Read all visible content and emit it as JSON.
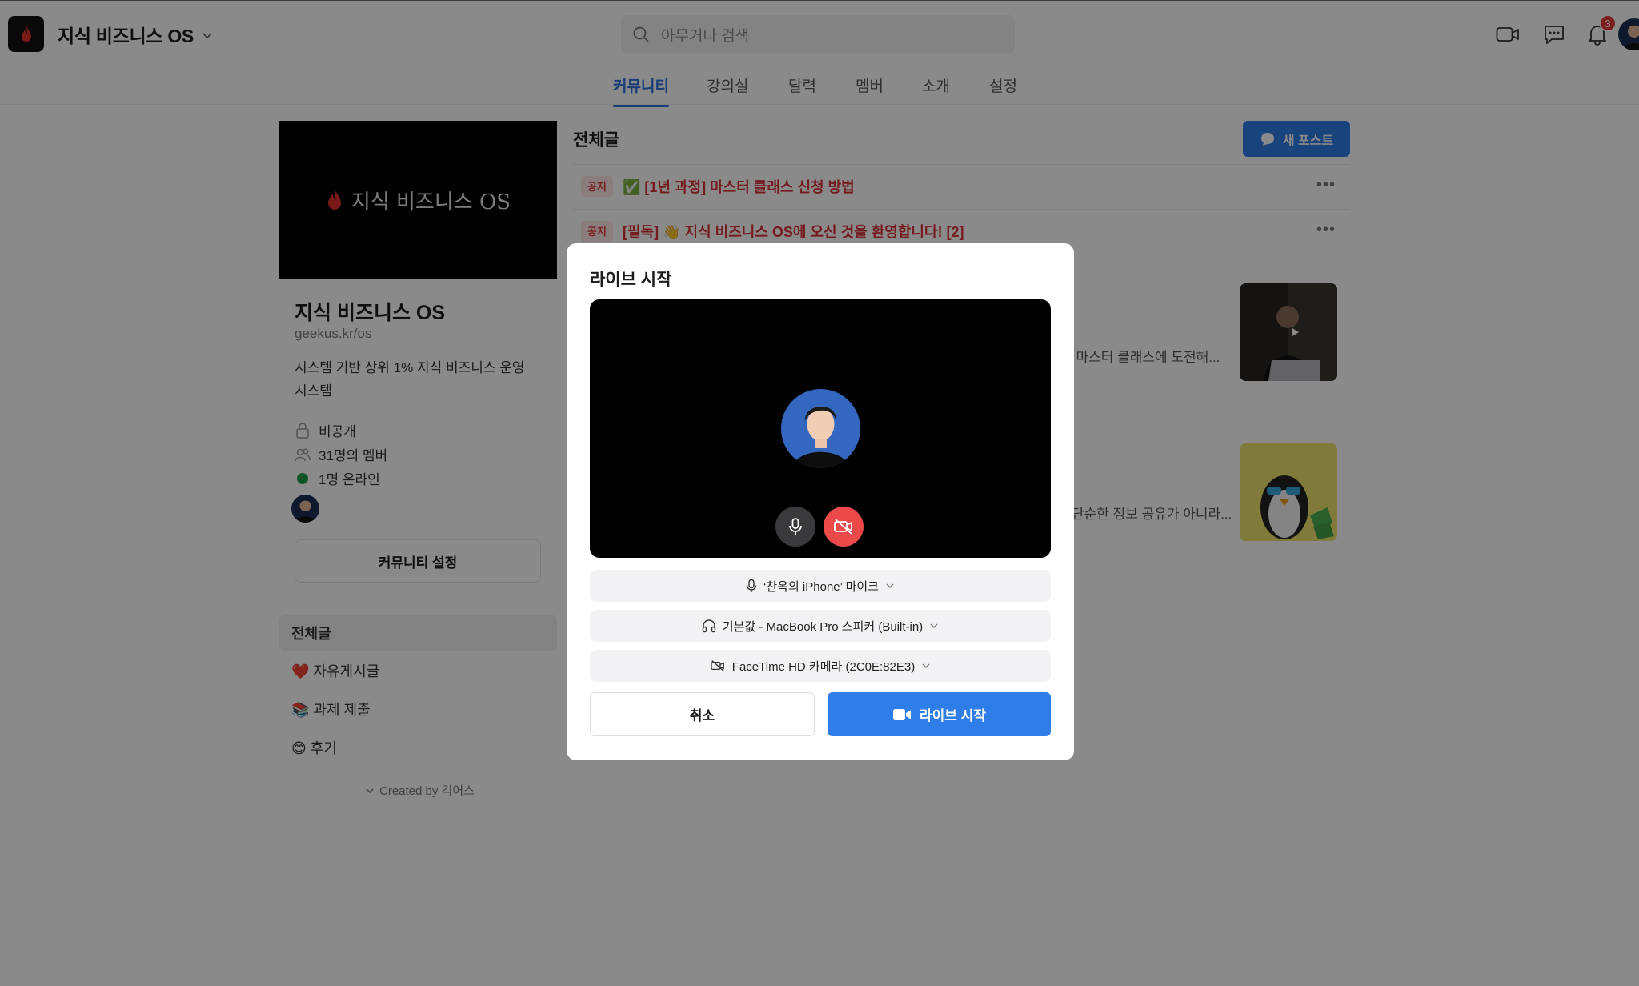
{
  "header": {
    "brand_title": "지식 비즈니스 OS",
    "search_placeholder": "아무거나 검색",
    "notification_count": "3",
    "tabs": [
      {
        "label": "커뮤니티",
        "active": true
      },
      {
        "label": "강의실"
      },
      {
        "label": "달력"
      },
      {
        "label": "멤버"
      },
      {
        "label": "소개"
      },
      {
        "label": "설정"
      }
    ]
  },
  "sidebar": {
    "cover_text": "지식 비즈니스 OS",
    "name": "지식 비즈니스 OS",
    "url": "geekus.kr/os",
    "description": "시스템 기반 상위 1% 지식 비즈니스 운영 시스템",
    "privacy": "비공개",
    "members": "31명의 멤버",
    "online": "1명 온라인",
    "settings_button": "커뮤니티 설정",
    "nav": [
      {
        "label": "전체글",
        "active": true
      },
      {
        "label": "❤️ 자유게시글"
      },
      {
        "label": "📚 과제 제출"
      },
      {
        "label": "😊 후기"
      }
    ],
    "created_by": "Created by 긱어스"
  },
  "feed": {
    "title": "전체글",
    "new_post_label": "새 포스트",
    "notices": [
      {
        "badge": "공지",
        "title": "✅ [1년 과정] 마스터 클래스 신청 방법"
      },
      {
        "badge": "공지",
        "title": "[필독] 👋 지식 비즈니스 OS에 오신 것을 환영합니다!  [2]"
      }
    ],
    "posts": [
      {
        "excerpt": ". 마스터 클래스에 도전해..."
      },
      {
        "excerpt": "단순한 정보 공유가 아니라..."
      }
    ]
  },
  "modal": {
    "title": "라이브 시작",
    "mic_device": "‘찬옥의 iPhone’ 마이크",
    "speaker_device": "기본값 - MacBook Pro 스피커 (Built-in)",
    "camera_device": "FaceTime HD 카메라 (2C0E:82E3)",
    "cancel_label": "취소",
    "start_label": "라이브 시작"
  },
  "colors": {
    "accent": "#2f7de8",
    "tab_active": "#2f6fdf",
    "notice_red": "#d8323a",
    "camera_off": "#ec4a4a",
    "online_green": "#1f9d48"
  }
}
